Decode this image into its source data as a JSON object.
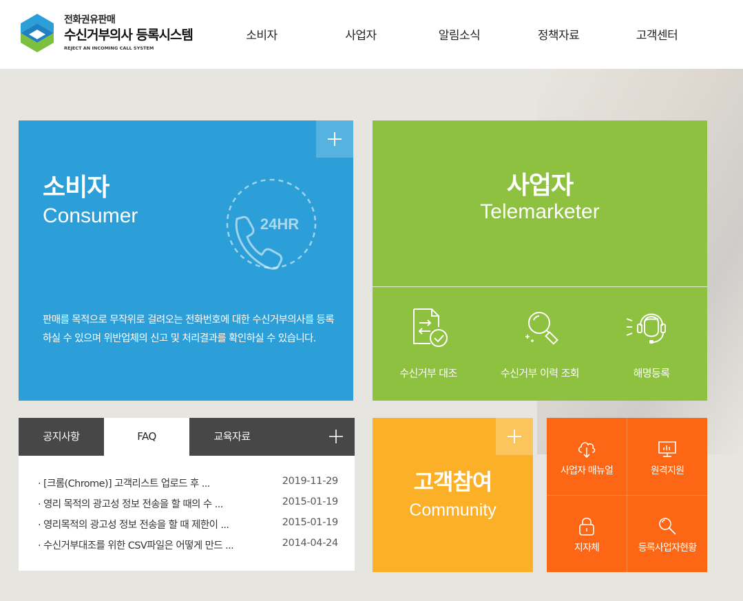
{
  "header": {
    "logo_sub": "전화권유판매",
    "logo_main": "수신거부의사 등록시스템",
    "logo_en": "REJECT AN INCOMING CALL SYSTEM",
    "nav": [
      "소비자",
      "사업자",
      "알림소식",
      "정책자료",
      "고객센터"
    ]
  },
  "consumer": {
    "title": "소비자",
    "subtitle": "Consumer",
    "badge": "24HR",
    "description": "판매를 목적으로 무작위로 걸려오는 전화번호에 대한 수신거부의사를 등록하실 수 있으며 위반업체의 신고 및 처리결과를 확인하실 수 있습니다."
  },
  "telemarketer": {
    "title": "사업자",
    "subtitle": "Telemarketer",
    "items": [
      {
        "label": "수신거부 대조",
        "icon": "document-compare-icon"
      },
      {
        "label": "수신거부 이력 조회",
        "icon": "magnifier-icon"
      },
      {
        "label": "해명등록",
        "icon": "headset-icon"
      }
    ]
  },
  "notice": {
    "tabs": [
      "공지사항",
      "FAQ",
      "교육자료"
    ],
    "active_tab": "FAQ",
    "rows": [
      {
        "title": "· [크롬(Chrome)] 고객리스트 업로드 후 ...",
        "date": "2019-11-29"
      },
      {
        "title": "· 영리 목적의 광고성 정보 전송을 할 때의 수 ...",
        "date": "2015-01-19"
      },
      {
        "title": "· 영리목적의 광고성 정보 전송을 할 때 제한이 ...",
        "date": "2015-01-19"
      },
      {
        "title": "· 수신거부대조를 위한 CSV파일은 어떻게 만드 ...",
        "date": "2014-04-24"
      }
    ]
  },
  "community": {
    "title": "고객참여",
    "subtitle": "Community"
  },
  "quick": [
    {
      "label": "사업자 매뉴얼",
      "icon": "cloud-download-icon"
    },
    {
      "label": "원격지원",
      "icon": "monitor-icon"
    },
    {
      "label": "지자체",
      "icon": "lock-icon"
    },
    {
      "label": "등록사업자현황",
      "icon": "search-icon"
    }
  ],
  "colors": {
    "consumer": "#2c9fd9",
    "telemarketer": "#8dc13f",
    "community": "#fbb027",
    "quick": "#fc6614",
    "tabs": "#474747"
  }
}
